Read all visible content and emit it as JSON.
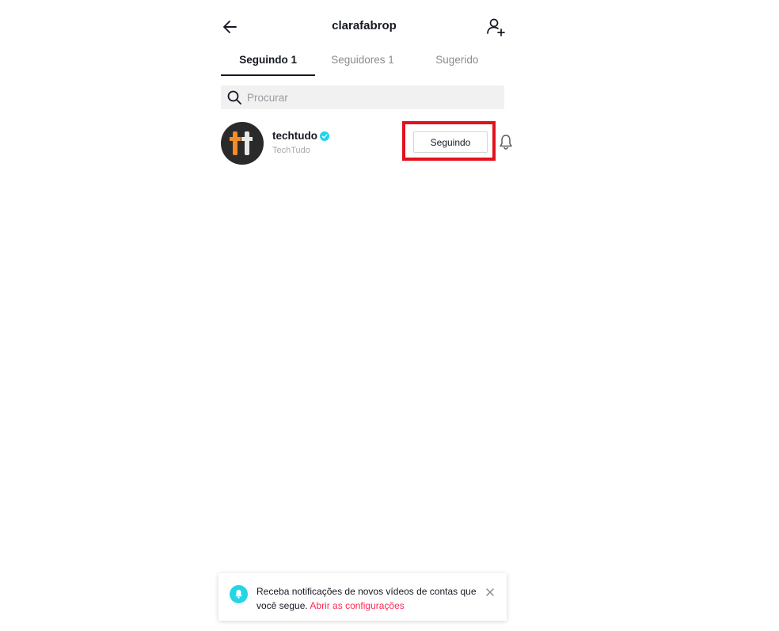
{
  "header": {
    "title": "clarafabrop"
  },
  "tabs": [
    {
      "label": "Seguindo 1",
      "active": true
    },
    {
      "label": "Seguidores 1",
      "active": false
    },
    {
      "label": "Sugerido",
      "active": false
    }
  ],
  "search": {
    "placeholder": "Procurar",
    "value": ""
  },
  "users": [
    {
      "username": "techtudo",
      "nickname": "TechTudo",
      "verified": true,
      "follow_label": "Seguindo",
      "avatar_letters": "tt"
    }
  ],
  "toast": {
    "message": "Receba notificações de novos vídeos de contas que você segue.",
    "link": "Abrir as configurações"
  },
  "colors": {
    "accent": "#fe2c55",
    "highlight": "#e3121e",
    "verified": "#20d5ec",
    "toast_icon": "#25d5e5",
    "avatar_bg": "#2b2a2b",
    "avatar_letter_orange": "#f28c28",
    "avatar_letter_white": "#e8e8e8"
  },
  "icons": {
    "back": "arrow-left-icon",
    "add_user": "add-user-icon",
    "search": "search-icon",
    "verified": "verified-badge-icon",
    "bell": "bell-icon",
    "close": "close-icon"
  }
}
